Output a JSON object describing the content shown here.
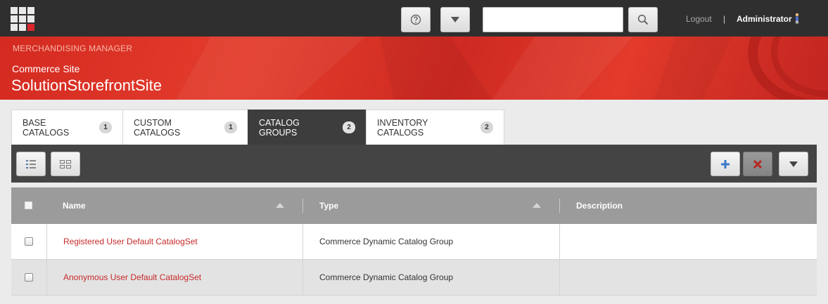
{
  "topbar": {
    "search": {
      "value": "",
      "placeholder": ""
    },
    "logout_label": "Logout",
    "separator": "|",
    "user_name": "Administrator",
    "icons": {
      "apps": "apps-grid-icon",
      "help": "help-icon",
      "menu": "dropdown-icon",
      "search": "search-icon",
      "user": "user-icon"
    }
  },
  "banner": {
    "app_name": "MERCHANDISING MANAGER",
    "site_label": "Commerce Site",
    "site_name": "SolutionStorefrontSite"
  },
  "tabs": [
    {
      "label": "BASE CATALOGS",
      "count": "1",
      "active": false
    },
    {
      "label": "CUSTOM CATALOGS",
      "count": "1",
      "active": false
    },
    {
      "label": "CATALOG GROUPS",
      "count": "2",
      "active": true
    },
    {
      "label": "INVENTORY CATALOGS",
      "count": "2",
      "active": false
    }
  ],
  "toolbar": {
    "left_icons": [
      "list-view-icon",
      "grid-view-icon"
    ],
    "right_icons": [
      "add-icon",
      "delete-icon",
      "more-actions-icon"
    ]
  },
  "table": {
    "columns": [
      "Name",
      "Type",
      "Description"
    ],
    "rows": [
      {
        "name": "Registered User Default CatalogSet",
        "type": "Commerce Dynamic Catalog Group",
        "description": ""
      },
      {
        "name": "Anonymous User Default CatalogSet",
        "type": "Commerce Dynamic Catalog Group",
        "description": ""
      }
    ]
  },
  "colors": {
    "topbar": "#2f2f2f",
    "brand_red": "#d8262b",
    "link_red": "#c72a2a",
    "toolbar": "#444444",
    "table_header": "#9b9b9b"
  }
}
